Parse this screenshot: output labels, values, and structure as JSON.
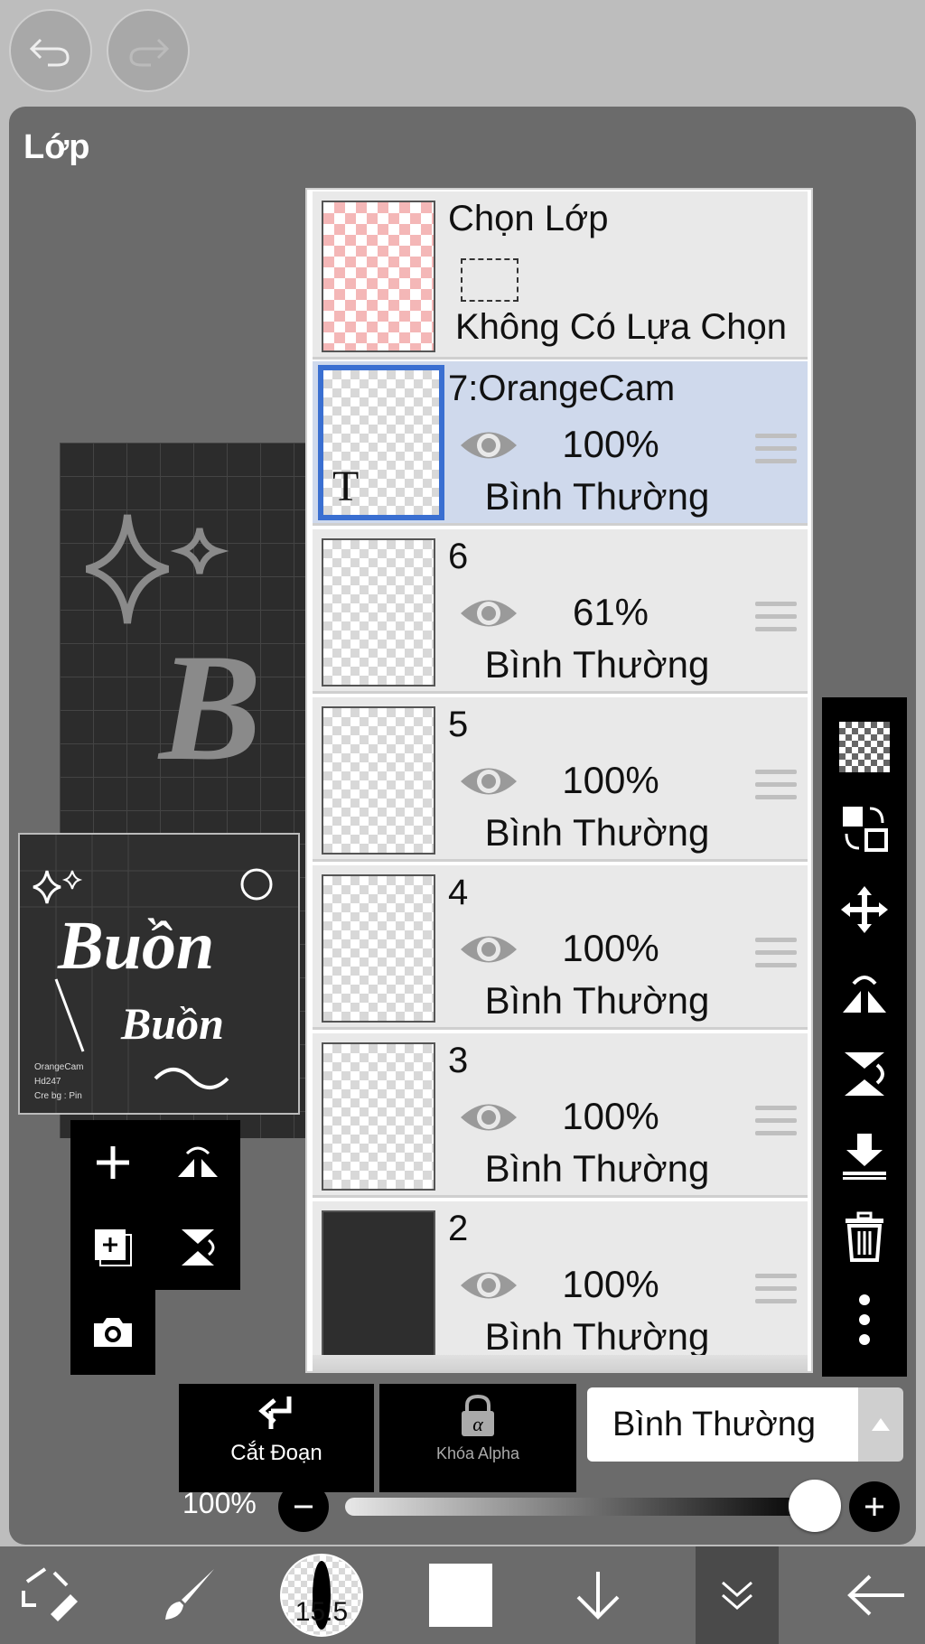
{
  "panel": {
    "title": "Lớp"
  },
  "top_bar": {
    "undo_icon": "undo-icon",
    "redo_icon": "redo-icon"
  },
  "preview": {
    "big_text": "Buồn",
    "small_text": "Buồn",
    "credits": [
      "OrangeCam",
      "Hd247",
      "Cre bg : Pin"
    ]
  },
  "selection_row": {
    "title": "Chọn Lớp",
    "status": "Không Có Lựa Chọn"
  },
  "layers": [
    {
      "name": "7:OrangeCam",
      "opacity": "100%",
      "blend": "Bình Thường",
      "selected": true,
      "thumb_letter": "T"
    },
    {
      "name": "6",
      "opacity": "61%",
      "blend": "Bình Thường",
      "selected": false
    },
    {
      "name": "5",
      "opacity": "100%",
      "blend": "Bình Thường",
      "selected": false
    },
    {
      "name": "4",
      "opacity": "100%",
      "blend": "Bình Thường",
      "selected": false
    },
    {
      "name": "3",
      "opacity": "100%",
      "blend": "Bình Thường",
      "selected": false
    },
    {
      "name": "2",
      "opacity": "100%",
      "blend": "Bình Thường",
      "selected": false
    }
  ],
  "bottom_controls": {
    "clipping_label": "Cắt Đoạn",
    "alpha_lock_label": "Khóa Alpha",
    "blend_mode_value": "Bình Thường",
    "opacity_label": "100%",
    "opacity_value": 1.0
  },
  "toolbar": {
    "brush_size": "15.5"
  },
  "colors": {
    "selected_row": "#cfd9ec",
    "selected_border": "#3a6fd1",
    "panel": "#6b6b6b"
  }
}
